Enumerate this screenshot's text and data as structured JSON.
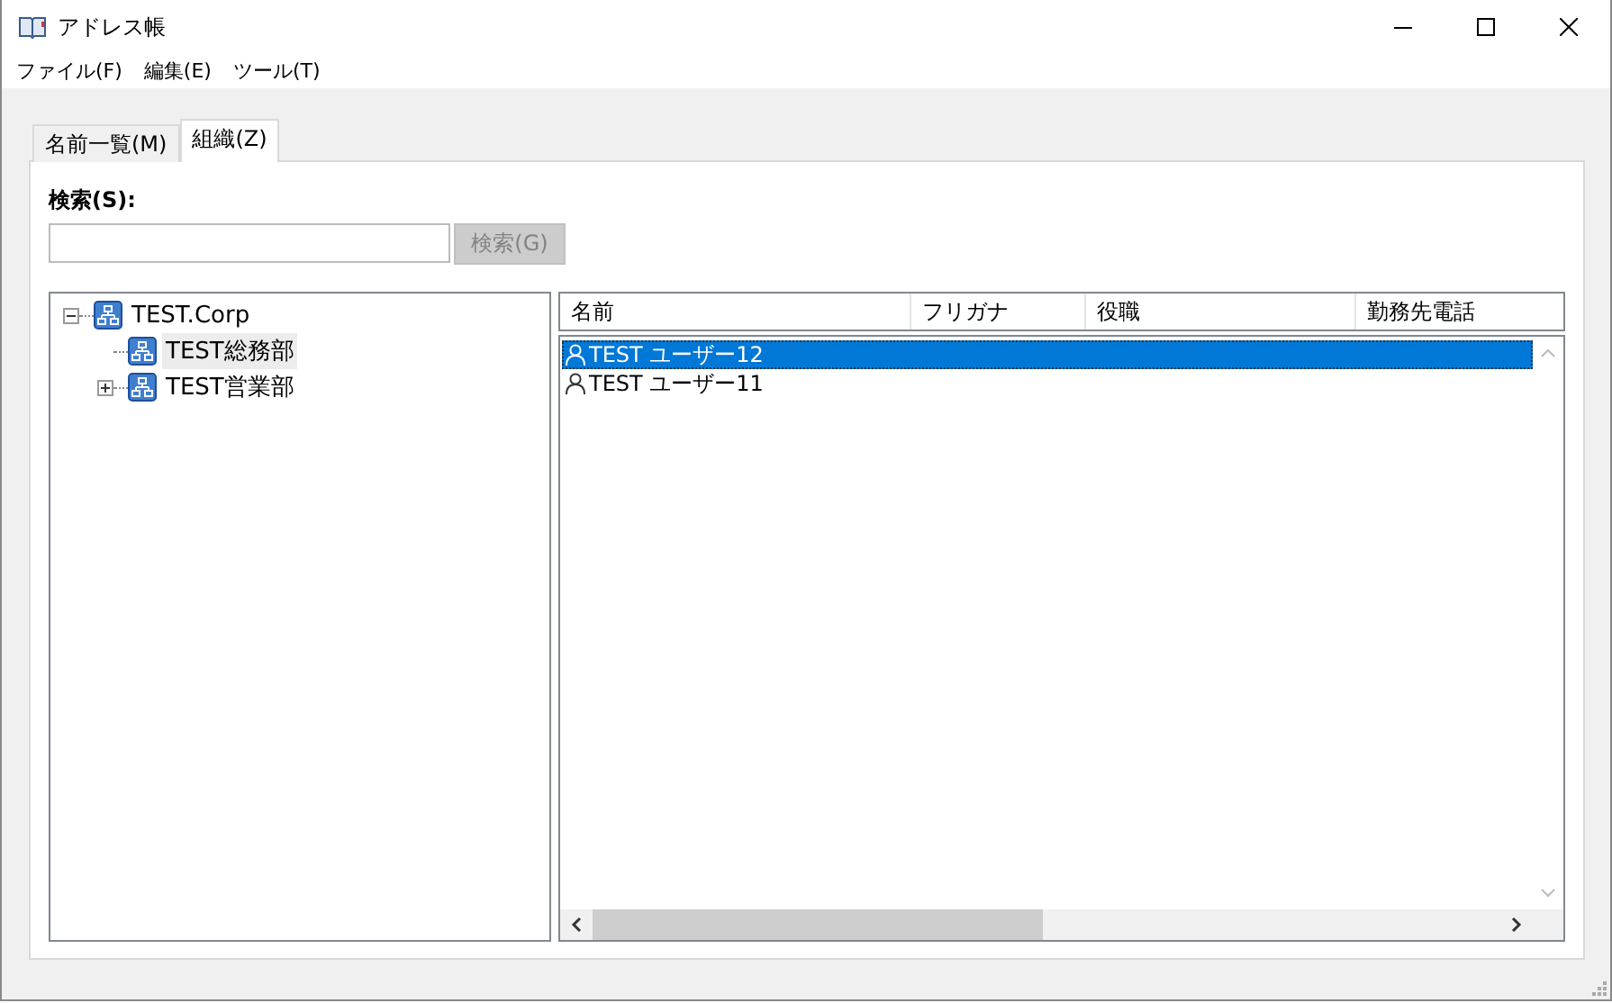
{
  "window": {
    "title": "アドレス帳"
  },
  "menu": [
    {
      "label": "ファイル(F)"
    },
    {
      "label": "編集(E)"
    },
    {
      "label": "ツール(T)"
    }
  ],
  "tabs": [
    {
      "label": "名前一覧(M)",
      "selected": false
    },
    {
      "label": "組織(Z)",
      "selected": true
    }
  ],
  "search": {
    "label": "検索(S):",
    "button": {
      "label": "検索(G)",
      "disabled": true
    }
  },
  "tree": [
    {
      "label": "TEST.Corp",
      "kind": "branch",
      "expanded": true,
      "selected": false,
      "children": [
        {
          "label": "TEST総務部",
          "kind": "leaf",
          "selected": true
        },
        {
          "label": "TEST営業部",
          "kind": "branch",
          "expanded": false,
          "selected": false
        }
      ]
    }
  ],
  "table": {
    "columns": [
      "名前",
      "フリガナ",
      "役職",
      "勤務先電話"
    ],
    "rows": [
      {
        "name": "TEST ユーザー12",
        "selected": true
      },
      {
        "name": "TEST ユーザー11",
        "selected": false
      }
    ]
  }
}
